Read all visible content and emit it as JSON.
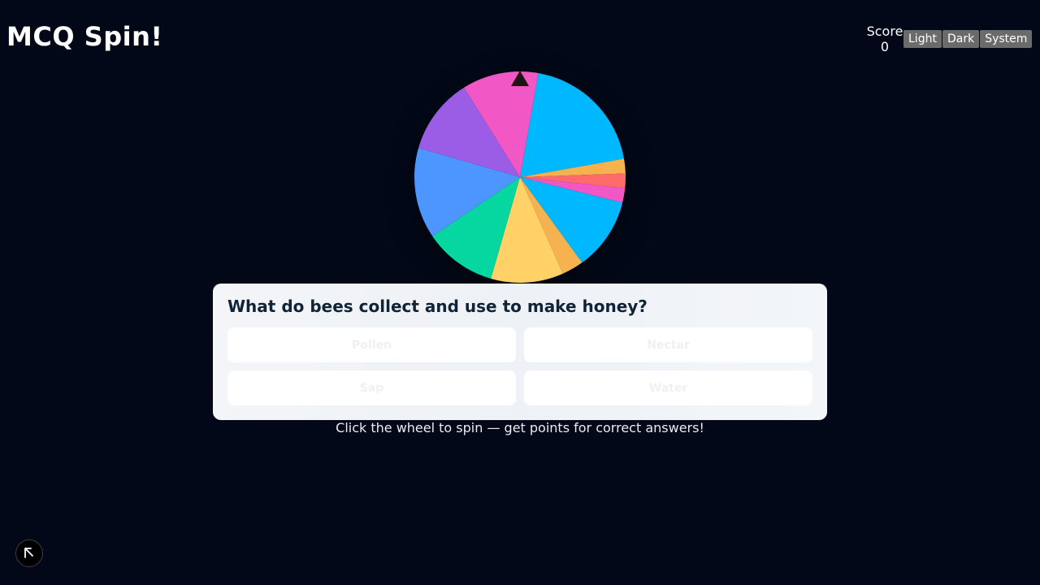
{
  "app": {
    "title": "MCQ Spin!"
  },
  "score": {
    "label": "Score",
    "value": "0"
  },
  "theme": {
    "buttons": [
      "Light",
      "Dark",
      "System"
    ]
  },
  "wheel": {
    "segments": [
      {
        "start": 10,
        "end": 80,
        "color": "#00b8ff"
      },
      {
        "start": 80,
        "end": 88,
        "color": "#f5b24f"
      },
      {
        "start": 88,
        "end": 96,
        "color": "#ff6b6b"
      },
      {
        "start": 96,
        "end": 104,
        "color": "#f158c5"
      },
      {
        "start": 104,
        "end": 144,
        "color": "#00b8ff"
      },
      {
        "start": 144,
        "end": 156,
        "color": "#f5b24f"
      },
      {
        "start": 156,
        "end": 196,
        "color": "#ffd166"
      },
      {
        "start": 196,
        "end": 236,
        "color": "#06d6a0"
      },
      {
        "start": 236,
        "end": 286,
        "color": "#4d96ff"
      },
      {
        "start": 286,
        "end": 328,
        "color": "#9b5de5"
      },
      {
        "start": 328,
        "end": 370,
        "color": "#f158c5"
      }
    ],
    "pointer_icon": "triangle-pointer-icon"
  },
  "question": {
    "text": "What do bees collect and use to make honey?",
    "options": [
      "Pollen",
      "Nectar",
      "Sap",
      "Water"
    ]
  },
  "hint": "Click the wheel to spin — get points for correct answers!",
  "floating_button": {
    "icon": "cursor-arrow-icon"
  }
}
